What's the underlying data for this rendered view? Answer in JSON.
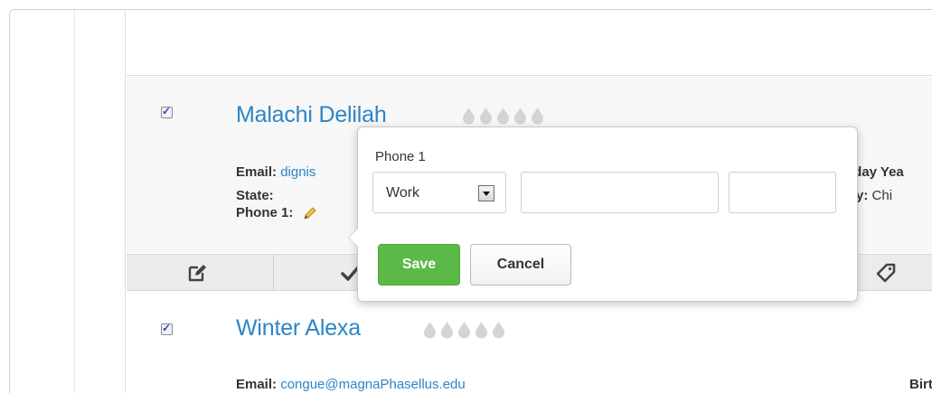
{
  "records": [
    {
      "name": "Malachi Delilah",
      "email_label": "Email:",
      "email_value": "dignis",
      "state_label": "State:",
      "phone_label": "Phone 1:",
      "right_label_1": "hday Yea",
      "right_label_2": "ntry:",
      "right_value_2": "Chi"
    },
    {
      "name": "Winter Alexa",
      "email_label": "Email:",
      "email_value": "congue@magnaPhasellus.edu",
      "right_label_1": "Birthday Yea"
    }
  ],
  "popover": {
    "title": "Phone 1",
    "type_select_value": "Work",
    "save_label": "Save",
    "cancel_label": "Cancel"
  },
  "toolbar": {
    "icons": [
      "edit-icon",
      "check-icon",
      "tag-icon"
    ]
  },
  "colors": {
    "link": "#2b86c6",
    "save": "#5cb847",
    "rating_drop": "#d4d4d4"
  }
}
